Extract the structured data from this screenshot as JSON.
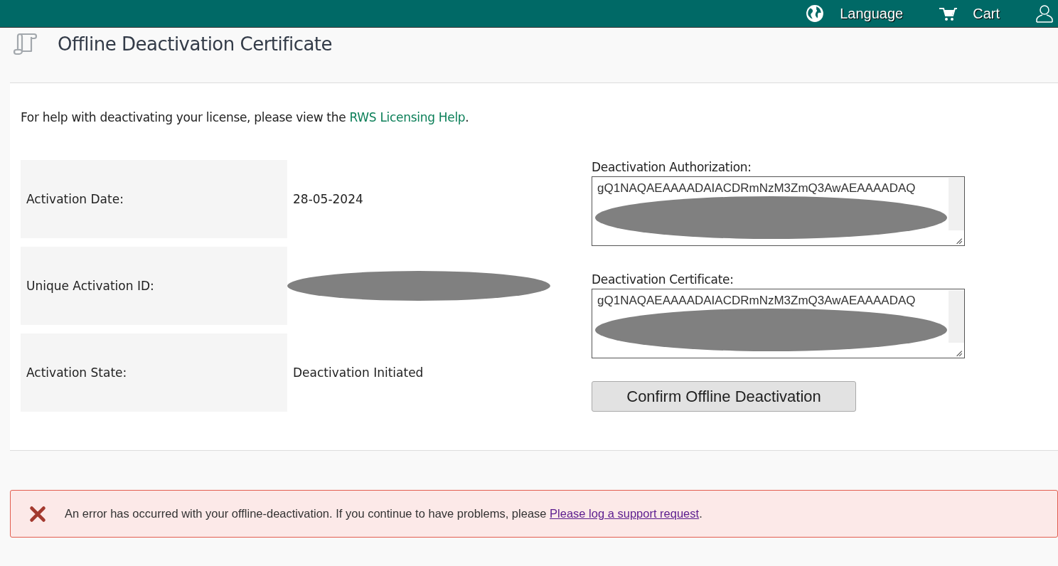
{
  "top_bar": {
    "items": [
      {
        "kind": "globe",
        "label": "Language"
      },
      {
        "kind": "cart",
        "label": "Cart"
      },
      {
        "kind": "user"
      }
    ]
  },
  "page_title": "Offline Deactivation Certificate",
  "help_text": {
    "before": "For help with deactivating your license, please view the",
    "link": "RWS Licensing Help",
    "after": "."
  },
  "details": [
    {
      "label": "Activation Date:",
      "value": "28-05-2024",
      "redacted": false
    },
    {
      "label": "Unique Activation ID:",
      "redacted": true
    },
    {
      "label": "Activation State:",
      "value": "Deactivation Initiated",
      "redacted": false
    }
  ],
  "fields": [
    {
      "label": "Deactivation Authorization:",
      "value": "gQ1NAQAEAAAADAIACDRmNzM3ZmQ3AwAEAAAADAQ",
      "redacted": true
    },
    {
      "label": "Deactivation Certificate:",
      "value": "gQ1NAQAEAAAADAIACDRmNzM3ZmQ3AwAEAAAADAQ",
      "redacted": true
    }
  ],
  "confirm_button": "Confirm Offline Deactivation",
  "error": {
    "message": "An error has occurred with your offline-deactivation. If you continue to have problems, please",
    "link": "Please log a support request",
    "after": "."
  }
}
